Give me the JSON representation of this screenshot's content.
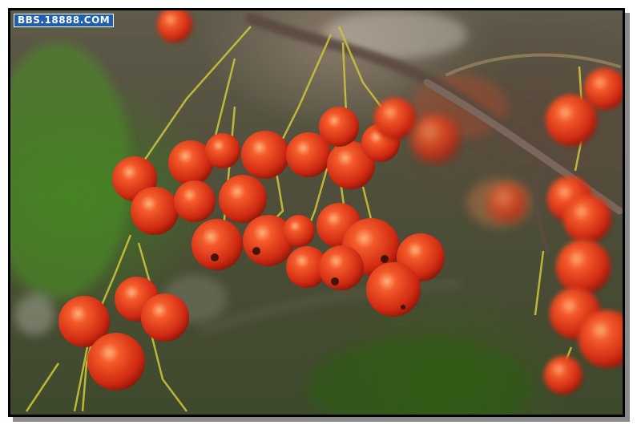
{
  "watermark": {
    "text": "BBS.18888.COM"
  },
  "photo": {
    "subject": "red-berries-branch-icon",
    "colors": {
      "berry": "#e0361a",
      "berry_highlight": "#ff8a55",
      "stem": "#c9c23a",
      "branch": "#5a4a40",
      "foliage": "#3f7a1f"
    }
  }
}
